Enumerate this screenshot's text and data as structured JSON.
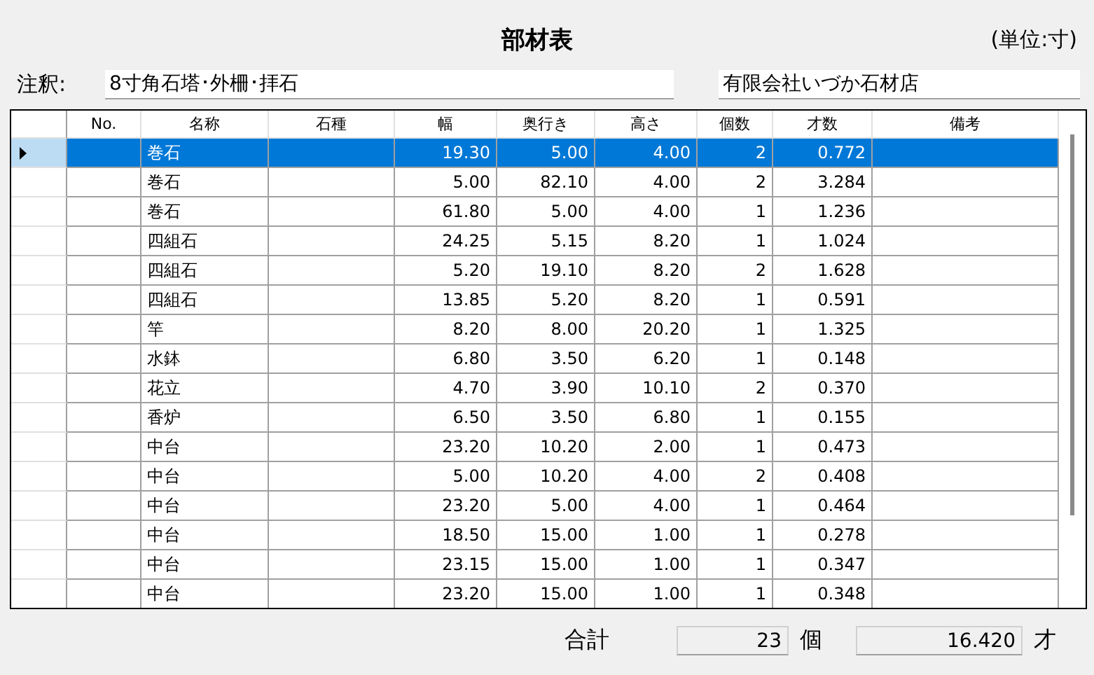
{
  "title": "部材表",
  "unit": "(単位:寸)",
  "note": {
    "label": "注釈:",
    "value": "8寸角石塔･外柵･拝石"
  },
  "company": {
    "value": "有限会社いづか石材店"
  },
  "table": {
    "columns": [
      "No.",
      "名称",
      "石種",
      "幅",
      "奥行き",
      "高さ",
      "個数",
      "才数",
      "備考"
    ],
    "rows": [
      {
        "selected": true,
        "cells": [
          "",
          "巻石",
          "",
          "19.30",
          "5.00",
          "4.00",
          "2",
          "0.772",
          ""
        ]
      },
      {
        "selected": false,
        "cells": [
          "",
          "巻石",
          "",
          "5.00",
          "82.10",
          "4.00",
          "2",
          "3.284",
          ""
        ]
      },
      {
        "selected": false,
        "cells": [
          "",
          "巻石",
          "",
          "61.80",
          "5.00",
          "4.00",
          "1",
          "1.236",
          ""
        ]
      },
      {
        "selected": false,
        "cells": [
          "",
          "四組石",
          "",
          "24.25",
          "5.15",
          "8.20",
          "1",
          "1.024",
          ""
        ]
      },
      {
        "selected": false,
        "cells": [
          "",
          "四組石",
          "",
          "5.20",
          "19.10",
          "8.20",
          "2",
          "1.628",
          ""
        ]
      },
      {
        "selected": false,
        "cells": [
          "",
          "四組石",
          "",
          "13.85",
          "5.20",
          "8.20",
          "1",
          "0.591",
          ""
        ]
      },
      {
        "selected": false,
        "cells": [
          "",
          "竿",
          "",
          "8.20",
          "8.00",
          "20.20",
          "1",
          "1.325",
          ""
        ]
      },
      {
        "selected": false,
        "cells": [
          "",
          "水鉢",
          "",
          "6.80",
          "3.50",
          "6.20",
          "1",
          "0.148",
          ""
        ]
      },
      {
        "selected": false,
        "cells": [
          "",
          "花立",
          "",
          "4.70",
          "3.90",
          "10.10",
          "2",
          "0.370",
          ""
        ]
      },
      {
        "selected": false,
        "cells": [
          "",
          "香炉",
          "",
          "6.50",
          "3.50",
          "6.80",
          "1",
          "0.155",
          ""
        ]
      },
      {
        "selected": false,
        "cells": [
          "",
          "中台",
          "",
          "23.20",
          "10.20",
          "2.00",
          "1",
          "0.473",
          ""
        ]
      },
      {
        "selected": false,
        "cells": [
          "",
          "中台",
          "",
          "5.00",
          "10.20",
          "4.00",
          "2",
          "0.408",
          ""
        ]
      },
      {
        "selected": false,
        "cells": [
          "",
          "中台",
          "",
          "23.20",
          "5.00",
          "4.00",
          "1",
          "0.464",
          ""
        ]
      },
      {
        "selected": false,
        "cells": [
          "",
          "中台",
          "",
          "18.50",
          "15.00",
          "1.00",
          "1",
          "0.278",
          ""
        ]
      },
      {
        "selected": false,
        "cells": [
          "",
          "中台",
          "",
          "23.15",
          "15.00",
          "1.00",
          "1",
          "0.347",
          ""
        ]
      },
      {
        "selected": false,
        "cells": [
          "",
          "中台",
          "",
          "23.20",
          "15.00",
          "1.00",
          "1",
          "0.348",
          ""
        ]
      }
    ]
  },
  "footer": {
    "label": "合計",
    "count": "23",
    "count_unit": "個",
    "volume": "16.420",
    "volume_unit": "才"
  }
}
